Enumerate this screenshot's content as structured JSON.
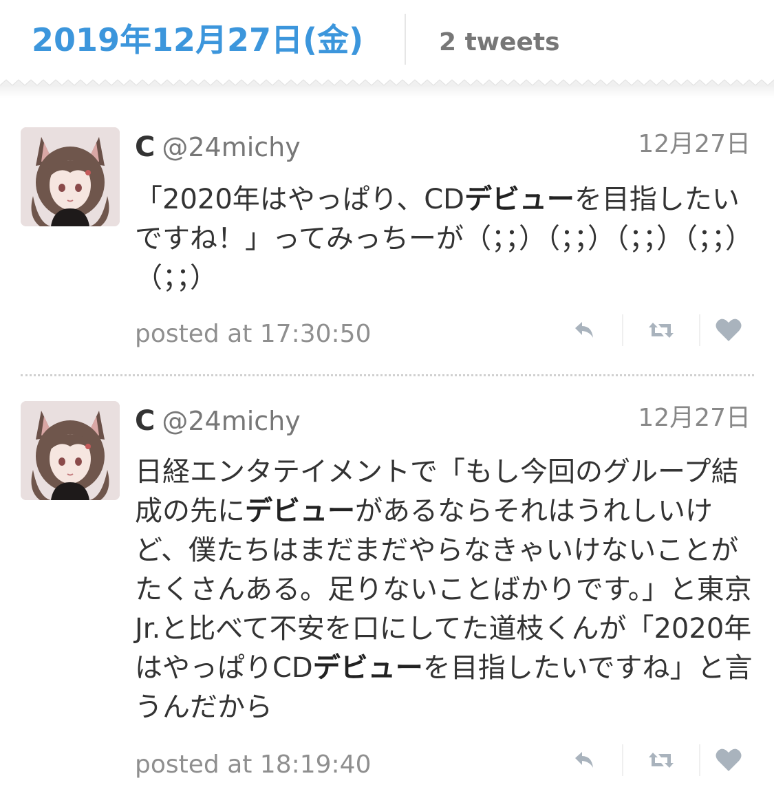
{
  "header": {
    "date": "2019年12月27日(金)",
    "count": "2 tweets"
  },
  "colors": {
    "accent": "#3c96dc",
    "muted": "#888888",
    "action": "#a9b3bd"
  },
  "tweets": [
    {
      "name": "C",
      "handle": "@24michy",
      "date": "12月27日",
      "text_segments": [
        {
          "t": "「2020年はやっぱり、CD",
          "b": false
        },
        {
          "t": "デビュー",
          "b": true
        },
        {
          "t": "を目指したいですね！」ってみっちーが（；；）（；；）（；；）（；；）（；；）",
          "b": false
        }
      ],
      "posted": "posted at 17:30:50",
      "actions": [
        "reply-icon",
        "retweet-icon",
        "like-icon"
      ]
    },
    {
      "name": "C",
      "handle": "@24michy",
      "date": "12月27日",
      "text_segments": [
        {
          "t": "日経エンタテイメントで「もし今回のグループ結成の先に",
          "b": false
        },
        {
          "t": "デビュー",
          "b": true
        },
        {
          "t": "があるならそれはうれしいけど、僕たちはまだまだやらなきゃいけないことがたくさんある。足りないことばかりです。」と東京Jr.と比べて不安を口にしてた道枝くんが「2020年はやっぱりCD",
          "b": false
        },
        {
          "t": "デビュー",
          "b": true
        },
        {
          "t": "を目指したいですね」と言うんだから",
          "b": false
        }
      ],
      "posted": "posted at 18:19:40",
      "actions": [
        "reply-icon",
        "retweet-icon",
        "like-icon"
      ]
    }
  ]
}
